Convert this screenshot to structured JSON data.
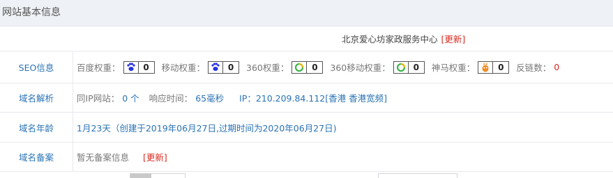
{
  "header": {
    "title": "网站基本信息"
  },
  "site": {
    "name": "北京爱心坊家政服务中心",
    "update_label": "[更新]"
  },
  "seo": {
    "label": "SEO信息",
    "baidu_label": "百度权重：",
    "baidu_value": "0",
    "mobile_label": "移动权重：",
    "mobile_value": "0",
    "s360_label": "360权重：",
    "s360_value": "0",
    "s360m_label": "360移动权重：",
    "s360m_value": "0",
    "shenma_label": "神马权重：",
    "shenma_value": "0",
    "backlinks_label": "反链数：",
    "backlinks_value": "0"
  },
  "dns": {
    "label": "域名解析",
    "same_ip_label": "同IP网站：",
    "same_ip_value": "0 个",
    "response_label": "响应时间：",
    "response_value": "65毫秒",
    "ip_text": "IP：210.209.84.112[香港 香港宽频]"
  },
  "age": {
    "label": "域名年龄",
    "text": "1月23天（创建于2019年06月27日,过期时间为2020年06月27日)"
  },
  "icp": {
    "label": "域名备案",
    "text": "暂无备案信息",
    "update_label": "[更新]"
  },
  "icons": {
    "baidu": "paw-icon",
    "mobile": "paw-icon",
    "s360": "ring-icon",
    "shenma": "horse-icon"
  },
  "colors": {
    "link": "#2a73b5",
    "alert": "#d9281f",
    "baidu": "#2932e1",
    "s360": "#3bb54a",
    "shenma": "#f08c1c"
  }
}
